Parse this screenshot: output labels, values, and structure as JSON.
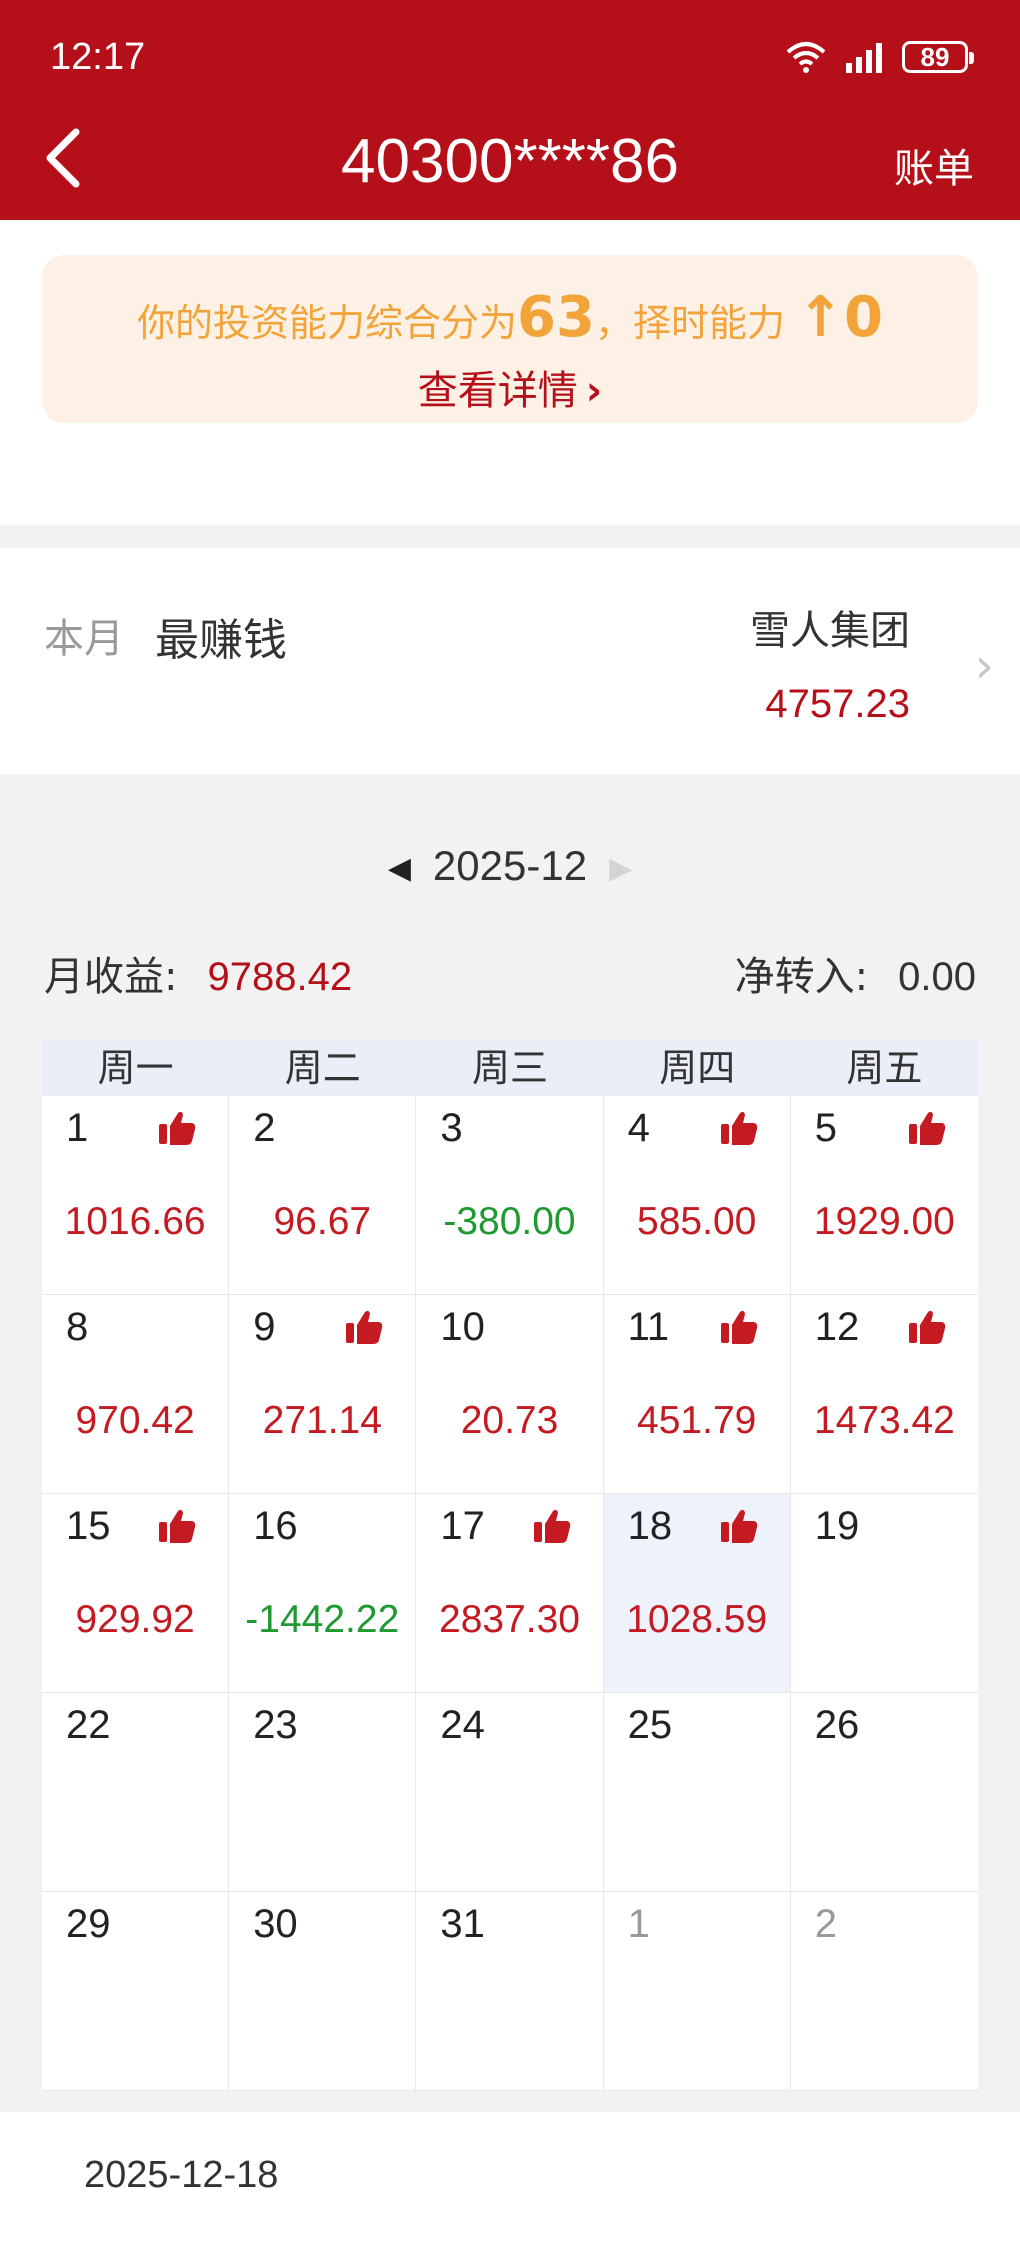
{
  "status_bar": {
    "time": "12:17",
    "battery": "89"
  },
  "header": {
    "title": "40300****86",
    "bill_label": "账单"
  },
  "score_banner": {
    "prefix": "你的投资能力综合分为",
    "score": "63",
    "middle": "，择时能力",
    "timing_arrow": "↑",
    "timing_value": "0",
    "detail_label": "查看详情"
  },
  "best": {
    "month_label": "本月",
    "label": "最赚钱",
    "name": "雪人集团",
    "value": "4757.23"
  },
  "month_nav": {
    "month": "2025-12"
  },
  "summary": {
    "income_label": "月收益:",
    "income_value": "9788.42",
    "net_label": "净转入:",
    "net_value": "0.00"
  },
  "calendar": {
    "weekdays": [
      "周一",
      "周二",
      "周三",
      "周四",
      "周五"
    ],
    "weeks": [
      [
        {
          "day": "1",
          "value": "1016.66",
          "sign": "pos",
          "thumb": true
        },
        {
          "day": "2",
          "value": "96.67",
          "sign": "pos",
          "thumb": false
        },
        {
          "day": "3",
          "value": "-380.00",
          "sign": "neg",
          "thumb": false
        },
        {
          "day": "4",
          "value": "585.00",
          "sign": "pos",
          "thumb": true
        },
        {
          "day": "5",
          "value": "1929.00",
          "sign": "pos",
          "thumb": true
        }
      ],
      [
        {
          "day": "8",
          "value": "970.42",
          "sign": "pos",
          "thumb": false
        },
        {
          "day": "9",
          "value": "271.14",
          "sign": "pos",
          "thumb": true
        },
        {
          "day": "10",
          "value": "20.73",
          "sign": "pos",
          "thumb": false
        },
        {
          "day": "11",
          "value": "451.79",
          "sign": "pos",
          "thumb": true
        },
        {
          "day": "12",
          "value": "1473.42",
          "sign": "pos",
          "thumb": true
        }
      ],
      [
        {
          "day": "15",
          "value": "929.92",
          "sign": "pos",
          "thumb": true
        },
        {
          "day": "16",
          "value": "-1442.22",
          "sign": "neg",
          "thumb": false
        },
        {
          "day": "17",
          "value": "2837.30",
          "sign": "pos",
          "thumb": true
        },
        {
          "day": "18",
          "value": "1028.59",
          "sign": "pos",
          "thumb": true,
          "selected": true
        },
        {
          "day": "19",
          "value": "",
          "sign": "",
          "thumb": false
        }
      ],
      [
        {
          "day": "22",
          "value": "",
          "sign": "",
          "thumb": false
        },
        {
          "day": "23",
          "value": "",
          "sign": "",
          "thumb": false
        },
        {
          "day": "24",
          "value": "",
          "sign": "",
          "thumb": false
        },
        {
          "day": "25",
          "value": "",
          "sign": "",
          "thumb": false
        },
        {
          "day": "26",
          "value": "",
          "sign": "",
          "thumb": false
        }
      ],
      [
        {
          "day": "29",
          "value": "",
          "sign": "",
          "thumb": false
        },
        {
          "day": "30",
          "value": "",
          "sign": "",
          "thumb": false
        },
        {
          "day": "31",
          "value": "",
          "sign": "",
          "thumb": false
        },
        {
          "day": "1",
          "value": "",
          "sign": "",
          "thumb": false,
          "other_month": true
        },
        {
          "day": "2",
          "value": "",
          "sign": "",
          "thumb": false,
          "other_month": true
        }
      ]
    ]
  },
  "selected_date": "2025-12-18",
  "colors": {
    "header_red": "#b51019",
    "gain_red": "#c41a21",
    "loss_green": "#1e9a31",
    "score_orange": "#f2a33a"
  }
}
